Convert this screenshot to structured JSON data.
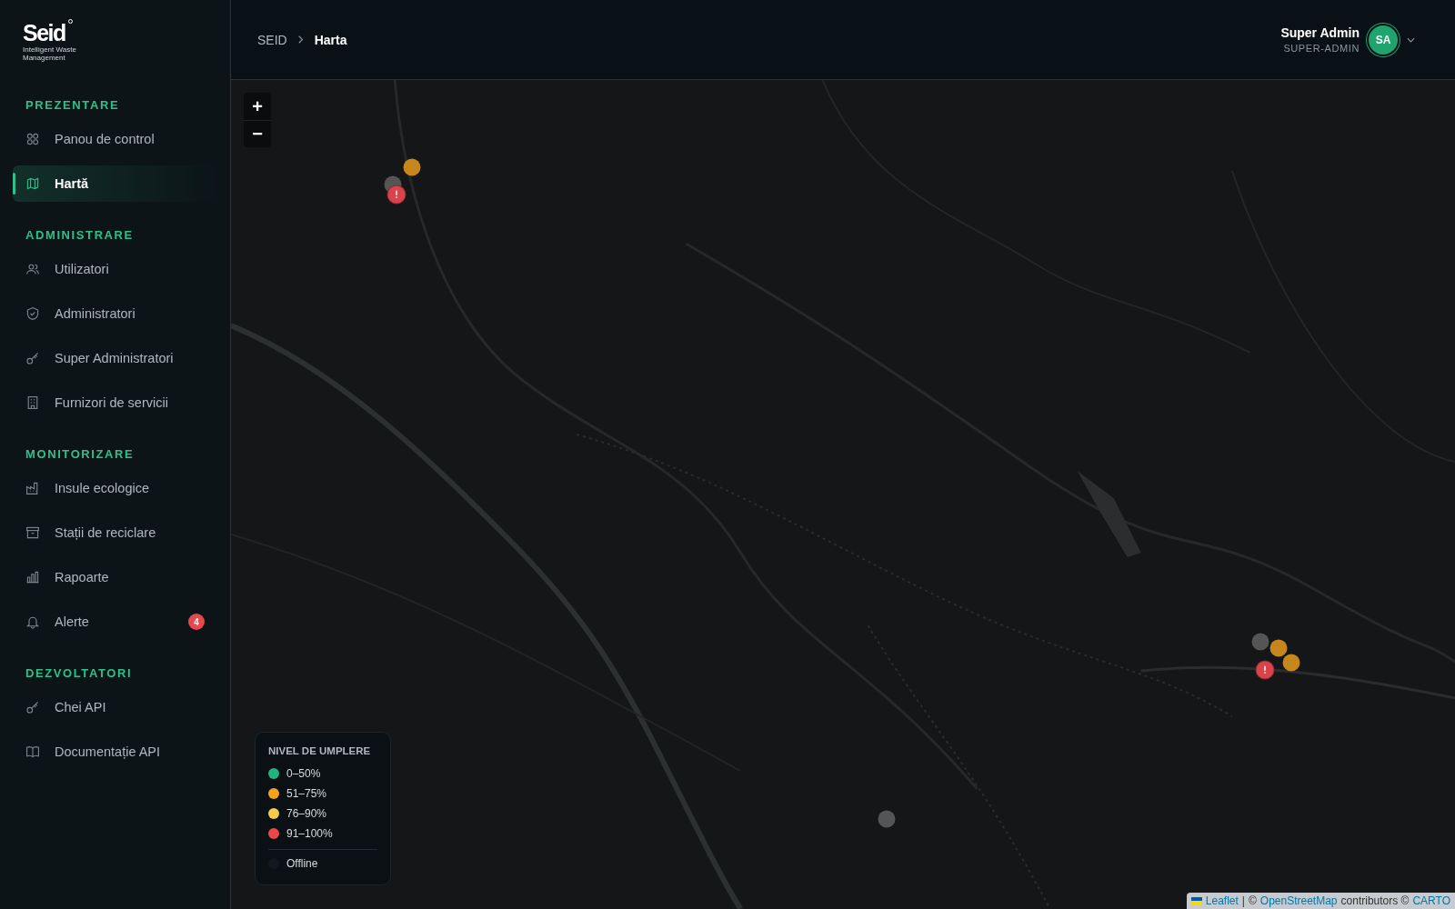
{
  "logo": {
    "name": "Seid",
    "tagline": "Intelligent Waste Management"
  },
  "sidebar": {
    "sections": [
      {
        "title": "PREZENTARE",
        "items": [
          {
            "label": "Panou de control",
            "selected": false
          },
          {
            "label": "Hartă",
            "selected": true
          }
        ]
      },
      {
        "title": "ADMINISTRARE",
        "items": [
          {
            "label": "Utilizatori",
            "selected": false
          },
          {
            "label": "Administratori",
            "selected": false
          },
          {
            "label": "Super Administratori",
            "selected": false
          },
          {
            "label": "Furnizori de servicii",
            "selected": false
          }
        ]
      },
      {
        "title": "MONITORIZARE",
        "items": [
          {
            "label": "Insule ecologice",
            "selected": false
          },
          {
            "label": "Stații de reciclare",
            "selected": false
          },
          {
            "label": "Rapoarte",
            "selected": false
          },
          {
            "label": "Alerte",
            "selected": false,
            "badge": "4"
          }
        ]
      },
      {
        "title": "DEZVOLTATORI",
        "items": [
          {
            "label": "Chei API",
            "selected": false
          },
          {
            "label": "Documentație API",
            "selected": false
          }
        ]
      }
    ]
  },
  "breadcrumb": [
    "SEID",
    "Harta"
  ],
  "user": {
    "name": "Super Admin",
    "role": "SUPER-ADMIN",
    "initials": "SA"
  },
  "map": {
    "zoom_buttons": [
      "+",
      "−"
    ],
    "markers": [
      {
        "color": "#c7861b",
        "alert": false
      },
      {
        "color": "#555555",
        "alert": false
      },
      {
        "color": "#d9434a",
        "alert": true
      },
      {
        "color": "#555555",
        "alert": false
      },
      {
        "color": "#c7861b",
        "alert": false
      },
      {
        "color": "#c7861b",
        "alert": false
      },
      {
        "color": "#d9434a",
        "alert": true
      },
      {
        "color": "#555555",
        "alert": false
      }
    ],
    "legend": {
      "title": "NIVEL DE UMPLERE",
      "items": [
        {
          "label": "0–50%",
          "color": "#1fb37f"
        },
        {
          "label": "51–75%",
          "color": "#f4a11d"
        },
        {
          "label": "76–90%",
          "color": "#f7cc48"
        },
        {
          "label": "91–100%",
          "color": "#e84848"
        }
      ],
      "offline": {
        "label": "Offline",
        "color": "#111820"
      }
    },
    "attribution": {
      "leaflet": "Leaflet",
      "sep": "|",
      "osm_prefix": "©",
      "osm": "OpenStreetMap",
      "contrib": "contributors ©",
      "carto": "CARTO"
    }
  }
}
